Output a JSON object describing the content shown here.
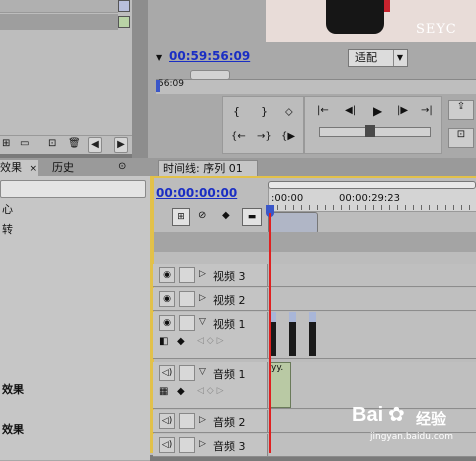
{
  "source_monitor": {
    "timecode": "00:59:56:09",
    "ruler_label": "56:09"
  },
  "program_monitor": {
    "fit_dropdown": "适配",
    "watermark": "SEYC"
  },
  "effects_panel": {
    "tab_effects": "效果",
    "tab_history": "历史",
    "items": [
      "心",
      "转",
      "",
      "",
      "",
      "",
      "",
      "",
      "",
      "效果",
      "",
      "效果",
      ""
    ]
  },
  "timeline": {
    "tab_label": "时间线: 序列 01",
    "timecode": "00:00:00:00",
    "ruler_start": ":00:00",
    "ruler_mid": "00:00:29:23",
    "tracks": [
      {
        "label": "视频 3",
        "type": "video",
        "expanded": false
      },
      {
        "label": "视频 2",
        "type": "video",
        "expanded": false
      },
      {
        "label": "视频 1",
        "type": "video",
        "expanded": true
      },
      {
        "label": "音频 1",
        "type": "audio",
        "expanded": true
      },
      {
        "label": "音频 2",
        "type": "audio",
        "expanded": false
      },
      {
        "label": "音频 3",
        "type": "audio",
        "expanded": false
      }
    ],
    "audio_clip_label": "yy."
  },
  "watermark": {
    "brand": "Bai",
    "brand_tail": "经验",
    "url": "jingyan.baidu.com"
  },
  "colors": {
    "accent_link": "#1a2ec4",
    "playhead": "#e02020",
    "panel_bg": "#c8c8c8"
  }
}
